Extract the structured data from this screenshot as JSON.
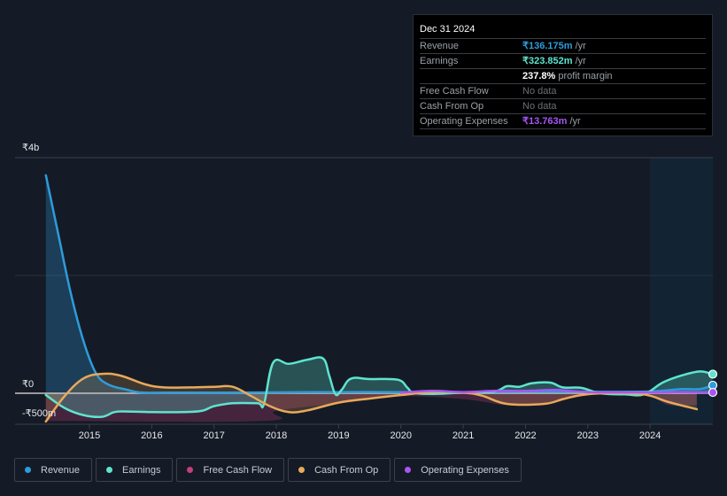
{
  "tooltip": {
    "date": "Dec 31 2024",
    "rows": [
      {
        "label": "Revenue",
        "value": "₹136.175m",
        "unit": " /yr",
        "color": "#2d9cdb"
      },
      {
        "label": "Earnings",
        "value": "₹323.852m",
        "unit": " /yr",
        "color": "#5ee4cf"
      },
      {
        "label": "",
        "value": "237.8%",
        "unit": " profit margin",
        "color": "#ffffff"
      },
      {
        "label": "Free Cash Flow",
        "value": "No data",
        "unit": "",
        "color": ""
      },
      {
        "label": "Cash From Op",
        "value": "No data",
        "unit": "",
        "color": ""
      },
      {
        "label": "Operating Expenses",
        "value": "₹13.763m",
        "unit": " /yr",
        "color": "#a855f7"
      }
    ]
  },
  "legend": [
    {
      "label": "Revenue",
      "color": "#2d9cdb"
    },
    {
      "label": "Earnings",
      "color": "#5ee4cf"
    },
    {
      "label": "Free Cash Flow",
      "color": "#c2407e"
    },
    {
      "label": "Cash From Op",
      "color": "#e8a95b"
    },
    {
      "label": "Operating Expenses",
      "color": "#a855f7"
    }
  ],
  "chart_data": {
    "type": "line",
    "title": "",
    "xlabel": "",
    "ylabel": "",
    "currency": "INR",
    "y_tick_labels": [
      {
        "value": 4000,
        "label": "₹4b"
      },
      {
        "value": 0,
        "label": "₹0"
      },
      {
        "value": -500,
        "label": "-₹500m"
      }
    ],
    "x_tick_labels": [
      "2015",
      "2016",
      "2017",
      "2018",
      "2019",
      "2020",
      "2021",
      "2022",
      "2023",
      "2024"
    ],
    "x_ticks": [
      2015,
      2016,
      2017,
      2018,
      2019,
      2020,
      2021,
      2022,
      2023,
      2024
    ],
    "xlim": [
      2014.3,
      2025.0
    ],
    "ylim": [
      -520,
      4000
    ],
    "forecast_highlight_start": 2024.0,
    "units": "₹ millions",
    "series": [
      {
        "name": "Revenue",
        "color": "#2d9cdb",
        "points": [
          [
            2014.3,
            3700
          ],
          [
            2014.5,
            2700
          ],
          [
            2014.7,
            1700
          ],
          [
            2014.9,
            900
          ],
          [
            2015.1,
            350
          ],
          [
            2015.3,
            150
          ],
          [
            2015.6,
            60
          ],
          [
            2015.8,
            15
          ],
          [
            2016.2,
            10
          ],
          [
            2017.0,
            10
          ],
          [
            2018.0,
            15
          ],
          [
            2019.0,
            20
          ],
          [
            2020.0,
            20
          ],
          [
            2021.0,
            20
          ],
          [
            2022.0,
            25
          ],
          [
            2023.0,
            25
          ],
          [
            2024.0,
            30
          ],
          [
            2024.5,
            70
          ],
          [
            2024.8,
            70
          ],
          [
            2025.0,
            136
          ]
        ]
      },
      {
        "name": "Earnings",
        "color": "#5ee4cf",
        "points": [
          [
            2014.3,
            -30
          ],
          [
            2014.6,
            -250
          ],
          [
            2014.9,
            -370
          ],
          [
            2015.2,
            -400
          ],
          [
            2015.4,
            -320
          ],
          [
            2015.6,
            -310
          ],
          [
            2016.0,
            -320
          ],
          [
            2016.5,
            -320
          ],
          [
            2016.8,
            -300
          ],
          [
            2017.0,
            -220
          ],
          [
            2017.3,
            -170
          ],
          [
            2017.7,
            -170
          ],
          [
            2017.8,
            -190
          ],
          [
            2017.95,
            520
          ],
          [
            2018.2,
            500
          ],
          [
            2018.5,
            570
          ],
          [
            2018.75,
            590
          ],
          [
            2018.85,
            300
          ],
          [
            2018.95,
            -20
          ],
          [
            2019.05,
            60
          ],
          [
            2019.2,
            250
          ],
          [
            2019.5,
            240
          ],
          [
            2019.95,
            230
          ],
          [
            2020.1,
            100
          ],
          [
            2020.2,
            10
          ],
          [
            2020.5,
            -10
          ],
          [
            2021.0,
            10
          ],
          [
            2021.5,
            30
          ],
          [
            2021.7,
            120
          ],
          [
            2021.9,
            110
          ],
          [
            2022.1,
            170
          ],
          [
            2022.4,
            180
          ],
          [
            2022.6,
            100
          ],
          [
            2022.9,
            90
          ],
          [
            2023.2,
            0
          ],
          [
            2023.6,
            -20
          ],
          [
            2023.9,
            -20
          ],
          [
            2024.2,
            180
          ],
          [
            2024.5,
            300
          ],
          [
            2024.8,
            370
          ],
          [
            2025.0,
            324
          ]
        ]
      },
      {
        "name": "Free Cash Flow",
        "color": "#c2407e",
        "points": [
          [
            2014.3,
            -470
          ],
          [
            2017.8,
            -470
          ],
          [
            2018.0,
            -300
          ],
          [
            2019.2,
            -150
          ],
          [
            2020.0,
            -50
          ],
          [
            2021.0,
            -100
          ],
          [
            2021.7,
            -200
          ],
          [
            2022.3,
            -190
          ],
          [
            2022.8,
            -70
          ],
          [
            2023.3,
            0
          ],
          [
            2023.9,
            0
          ],
          [
            2024.3,
            -200
          ],
          [
            2024.75,
            -200
          ]
        ]
      },
      {
        "name": "Cash From Op",
        "color": "#e8a95b",
        "points": [
          [
            2014.3,
            -480
          ],
          [
            2014.6,
            -50
          ],
          [
            2014.9,
            250
          ],
          [
            2015.2,
            330
          ],
          [
            2015.5,
            300
          ],
          [
            2015.9,
            150
          ],
          [
            2016.2,
            100
          ],
          [
            2016.6,
            100
          ],
          [
            2017.0,
            110
          ],
          [
            2017.3,
            110
          ],
          [
            2017.6,
            -50
          ],
          [
            2017.9,
            -220
          ],
          [
            2018.2,
            -320
          ],
          [
            2018.5,
            -290
          ],
          [
            2019.0,
            -160
          ],
          [
            2019.5,
            -90
          ],
          [
            2020.0,
            -30
          ],
          [
            2020.5,
            20
          ],
          [
            2021.0,
            10
          ],
          [
            2021.3,
            -40
          ],
          [
            2021.7,
            -180
          ],
          [
            2022.3,
            -180
          ],
          [
            2022.6,
            -100
          ],
          [
            2022.9,
            -30
          ],
          [
            2023.3,
            0
          ],
          [
            2023.9,
            -20
          ],
          [
            2024.3,
            -150
          ],
          [
            2024.75,
            -270
          ]
        ]
      },
      {
        "name": "Operating Expenses",
        "color": "#a855f7",
        "points": [
          [
            2020.0,
            10
          ],
          [
            2020.5,
            40
          ],
          [
            2021.0,
            20
          ],
          [
            2021.5,
            40
          ],
          [
            2022.0,
            40
          ],
          [
            2022.5,
            55
          ],
          [
            2023.0,
            20
          ],
          [
            2024.0,
            15
          ],
          [
            2024.5,
            20
          ],
          [
            2025.0,
            14
          ]
        ]
      }
    ]
  }
}
